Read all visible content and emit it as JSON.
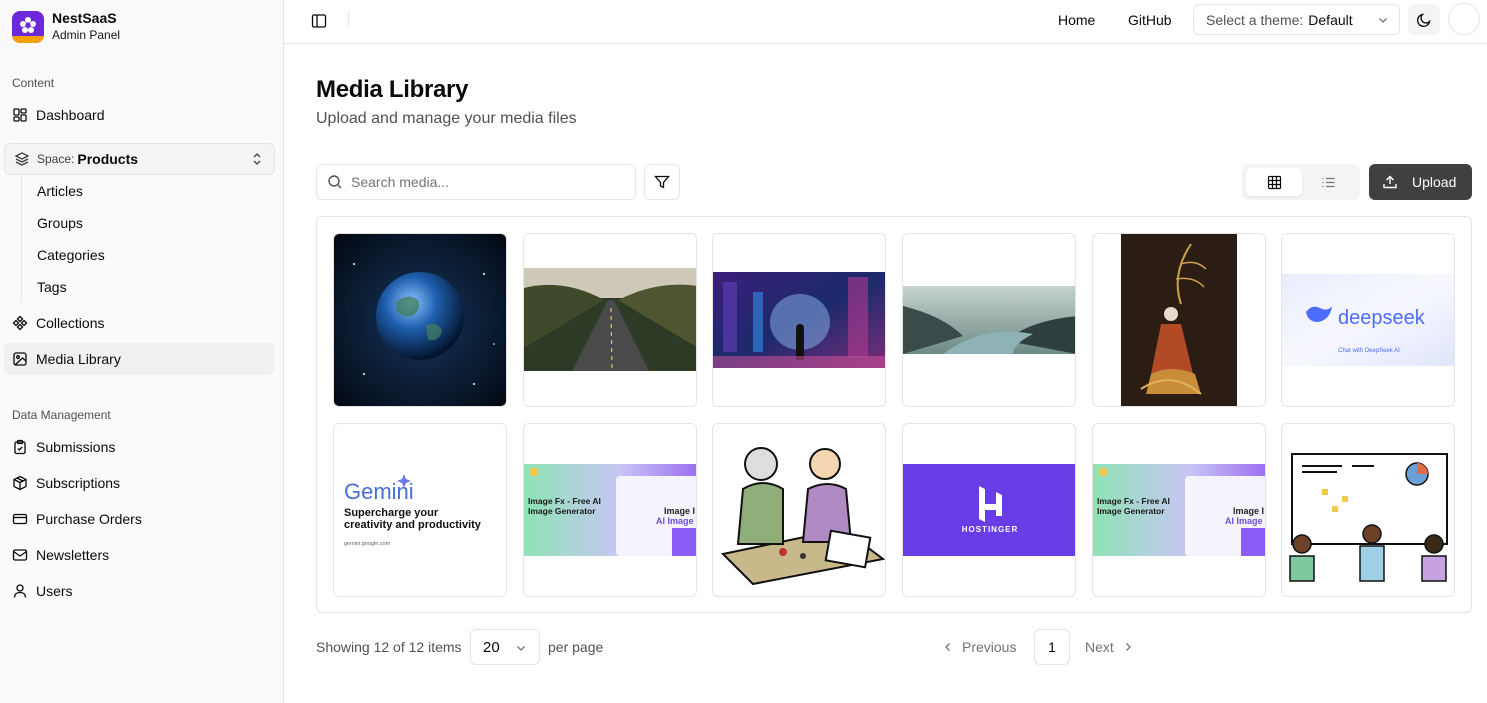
{
  "brand": {
    "title": "NestSaaS",
    "subtitle": "Admin Panel"
  },
  "sidebar": {
    "content_label": "Content",
    "dashboard": "Dashboard",
    "space": {
      "label": "Space:",
      "value": "Products"
    },
    "space_items": [
      "Articles",
      "Groups",
      "Categories",
      "Tags"
    ],
    "collections": "Collections",
    "media_library": "Media Library",
    "data_label": "Data Management",
    "data_items": [
      "Submissions",
      "Subscriptions",
      "Purchase Orders",
      "Newsletters",
      "Users"
    ]
  },
  "topbar": {
    "home": "Home",
    "github": "GitHub",
    "theme_prefix": "Select a theme:",
    "theme_value": "Default"
  },
  "page": {
    "title": "Media Library",
    "subtitle": "Upload and manage your media files"
  },
  "toolbar": {
    "search_placeholder": "Search media...",
    "upload_label": "Upload"
  },
  "media": {
    "gemini_title": "Gemini",
    "gemini_tagline_1": "Supercharge your",
    "gemini_tagline_2": "creativity and productivity",
    "gemini_url": "gemini.google.com",
    "deepseek_title": "deepseek",
    "deepseek_sub": "Chat with DeepSeek AI",
    "hostinger_title": "HOSTINGER",
    "imagefx_title": "Image Fx - Free AI Image Generator",
    "imagefx_side": "Image AI Image"
  },
  "pagination": {
    "showing": "Showing 12 of 12 items",
    "per_page_value": "20",
    "per_page_label": "per page",
    "previous": "Previous",
    "page": "1",
    "next": "Next"
  },
  "colors": {
    "brand_purple": "#6d28d9",
    "upload_bg": "#404040",
    "hostinger": "#673de6",
    "deepseek": "#4d6bfe"
  }
}
